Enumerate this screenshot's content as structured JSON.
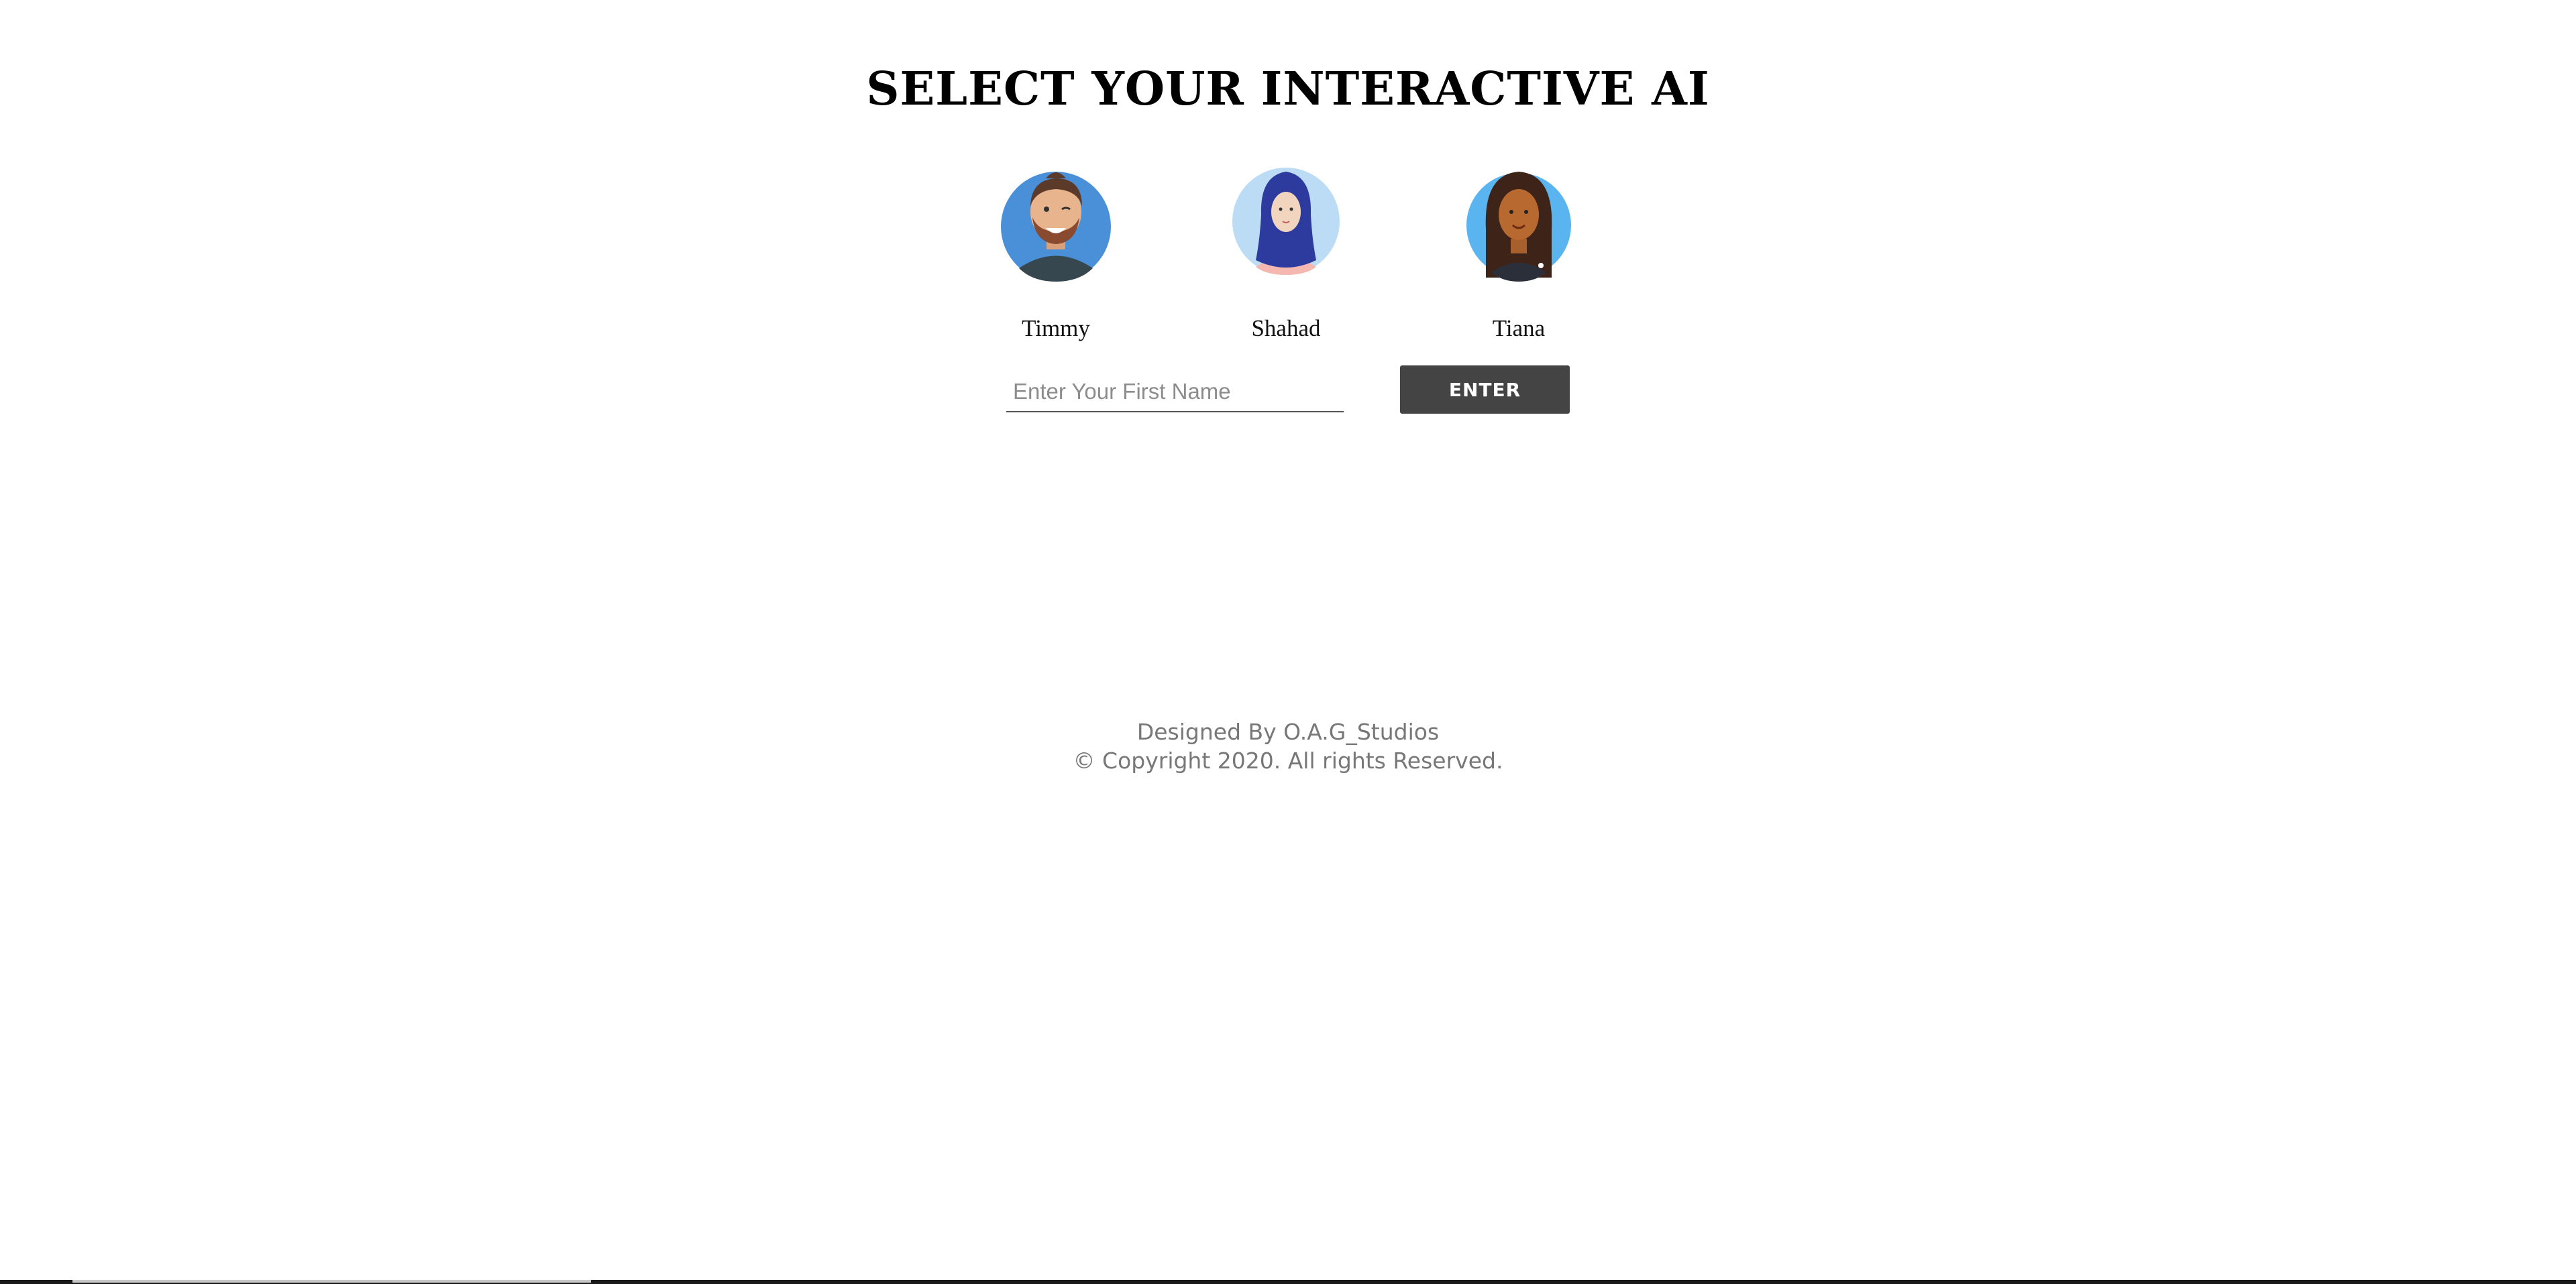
{
  "header": {
    "title": "SELECT YOUR INTERACTIVE AI"
  },
  "avatars": [
    {
      "name": "Timmy",
      "icon": "male-avatar-icon",
      "bg_color": "#4a90d9"
    },
    {
      "name": "Shahad",
      "icon": "hijab-avatar-icon",
      "bg_color": "#bcdcf5"
    },
    {
      "name": "Tiana",
      "icon": "female-avatar-icon",
      "bg_color": "#5ab4f0"
    }
  ],
  "form": {
    "name_placeholder": "Enter Your First Name",
    "name_value": "",
    "enter_label": "ENTER",
    "button_color": "#444444"
  },
  "footer": {
    "designed_by": "Designed By O.A.G_Studios",
    "copyright": "© Copyright 2020. All rights Reserved."
  }
}
